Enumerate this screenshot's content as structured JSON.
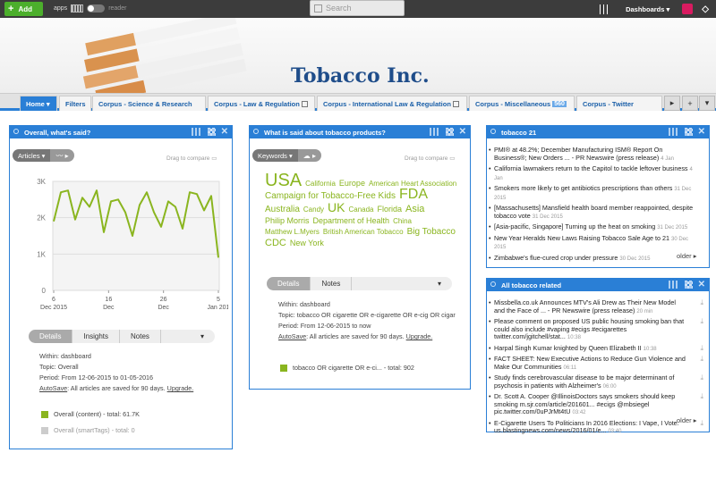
{
  "topbar": {
    "add_label": "Add",
    "apps_label": "apps",
    "reader_label": "reader",
    "search_placeholder": "Search",
    "dashboards_label": "Dashboards",
    "icons": [
      "grid-icon",
      "toggle-icon",
      "search-icon",
      "sliders-icon",
      "avatar-icon",
      "diamond-icon"
    ]
  },
  "banner": {
    "title": "Tobacco Inc."
  },
  "tabs": [
    {
      "label": "Home"
    },
    {
      "label": "Filters"
    },
    {
      "label": "Corpus - Science & Research"
    },
    {
      "label": "Corpus - Law & Regulation"
    },
    {
      "label": "Corpus - International Law & Regulation"
    },
    {
      "label": "Corpus - Miscellaneous",
      "badge": "560"
    },
    {
      "label": "Corpus - Twitter"
    }
  ],
  "panel1": {
    "title": "Overall, what's said?",
    "select_label": "Articles",
    "drag_label": "Drag to compare",
    "chart_data": {
      "type": "line",
      "x": [
        "6 Dec 2015",
        "16 Dec",
        "26 Dec",
        "5 Jan 2016"
      ],
      "y_ticks": [
        "3K",
        "2K",
        "1K",
        "0"
      ],
      "x_ticks": [
        [
          "6",
          "Dec 2015"
        ],
        [
          "16",
          "Dec"
        ],
        [
          "26",
          "Dec"
        ],
        [
          "5",
          "Jan 201"
        ]
      ],
      "ylim": [
        0,
        3000
      ],
      "color": "#8ab51f",
      "values": [
        1900,
        2700,
        2750,
        1950,
        2550,
        2300,
        2750,
        1600,
        2450,
        2500,
        2150,
        1500,
        2350,
        2700,
        2150,
        1750,
        2450,
        2300,
        1700,
        2700,
        2650,
        2200,
        2600,
        900
      ]
    },
    "tabs": [
      "Details",
      "Insights",
      "Notes"
    ],
    "within": "Within: dashboard",
    "topic": "Topic: Overall",
    "period": "Period: From 12-06-2015 to 01-05-2016",
    "autosave": "AutoSave",
    "autosave_text": ": All articles are saved for 90 days.",
    "upgrade": "Upgrade.",
    "legend": [
      {
        "label": "Overall (content) - total: 61.7K",
        "color": "#8ab51f"
      },
      {
        "label": "Overall (smartTags) - total: 0",
        "color": "#cccccc"
      }
    ]
  },
  "panel2": {
    "title": "What is said about tobacco products?",
    "select_label": "Keywords",
    "drag_label": "Drag to compare",
    "cloud": [
      {
        "w": "USA",
        "s": 20
      },
      {
        "w": "California",
        "s": 8
      },
      {
        "w": "Europe",
        "s": 9
      },
      {
        "w": "American Heart Association",
        "s": 8
      },
      {
        "w": "Campaign for Tobacco-Free Kids",
        "s": 10
      },
      {
        "w": "FDA",
        "s": 16
      },
      {
        "w": "Australia",
        "s": 10
      },
      {
        "w": "Candy",
        "s": 8
      },
      {
        "w": "UK",
        "s": 14
      },
      {
        "w": "Canada",
        "s": 8
      },
      {
        "w": "Florida",
        "s": 9
      },
      {
        "w": "Asia",
        "s": 11
      },
      {
        "w": "Philip Morris",
        "s": 9
      },
      {
        "w": "Department of Health",
        "s": 9
      },
      {
        "w": "China",
        "s": 8
      },
      {
        "w": "Matthew L.Myers",
        "s": 8
      },
      {
        "w": "British American Tobacco",
        "s": 8
      },
      {
        "w": "Big Tobacco",
        "s": 10
      },
      {
        "w": "CDC",
        "s": 11
      },
      {
        "w": "New York",
        "s": 9
      }
    ],
    "tabs": [
      "Details",
      "Notes"
    ],
    "within": "Within: dashboard",
    "topic": "Topic: tobacco OR cigarette OR e-cigarette OR e-cig OR cigar",
    "period": "Period: From 12-06-2015 to now",
    "autosave": "AutoSave",
    "autosave_text": ": All articles are saved for 90 days.",
    "upgrade": "Upgrade.",
    "legend": {
      "label": "tobacco OR cigarette OR e-ci... - total: 902",
      "color": "#8ab51f"
    }
  },
  "panel3": {
    "title": "tobacco 21",
    "items": [
      {
        "text": "PMI® at 48.2%; December Manufacturing ISM® Report On Business®; New Orders ... - PR Newswire (press release)",
        "time": "4 Jan"
      },
      {
        "text": "California lawmakers return to the Capitol to tackle leftover business",
        "time": "4 Jan"
      },
      {
        "text": "Smokers more likely to get antibiotics prescriptions than others",
        "time": "31 Dec 2015"
      },
      {
        "text": "[Massachusetts] Mansfield health board member reappointed, despite tobacco vote",
        "time": "31 Dec 2015"
      },
      {
        "text": "[Asia-pacific, Singapore] Turning up the heat on smoking",
        "time": "31 Dec 2015"
      },
      {
        "text": "New Year Heralds New Laws Raising Tobacco Sale Age to 21",
        "time": "30 Dec 2015"
      },
      {
        "text": "Zimbabwe's flue-cured crop under pressure",
        "time": "30 Dec 2015"
      }
    ],
    "older": "older"
  },
  "panel4": {
    "title": "All tobacco related",
    "items": [
      {
        "text": "Missbella.co.uk Announces MTV's Ali Drew as Their New Model and the Face of ... - PR Newswire (press release)",
        "time": "20 min"
      },
      {
        "text": "Please comment on proposed US public housing smoking ban that could also include #vaping #ecigs #ecigarettes twitter.com/jgitchell/stat...",
        "time": "10:38"
      },
      {
        "text": "Harpal Singh Kumar knighted by Queen Elizabeth II",
        "time": "10:38"
      },
      {
        "text": "FACT SHEET: New Executive Actions to Reduce Gun Violence and Make Our Communities",
        "time": "06:11"
      },
      {
        "text": "Study finds cerebrovascular disease to be major determinant of psychosis in patients with Alzheimer's",
        "time": "06:00"
      },
      {
        "text": "Dr. Scott A. Cooper @IllinoisDoctors says smokers should keep smoking m.sjr.com/article/201601... #ecigs @mbsiegel pic.twitter.com/0uPJrMt4tU",
        "time": "03:42"
      },
      {
        "text": "E-Cigarette Users To Politicians In 2016 Elections: I Vape, I Vote. us.blastingnews.com/news/2016/01/e...",
        "time": "03:40"
      }
    ],
    "older": "older"
  }
}
